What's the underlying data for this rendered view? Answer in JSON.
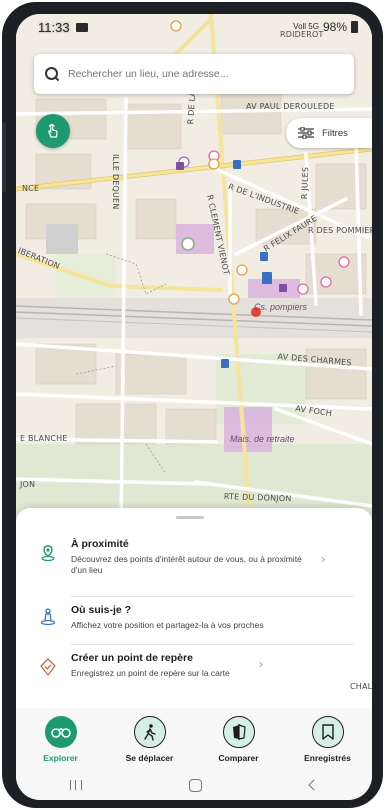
{
  "status_bar": {
    "time": "11:33",
    "network": "Voll 5G",
    "battery": "98%"
  },
  "search": {
    "placeholder": "Rechercher un lieu, une adresse..."
  },
  "map": {
    "filters_label": "Filtres",
    "street_labels": [
      "AV PAUL DEROULEDE",
      "R DE LA BIENFAI",
      "R JULES",
      "R DE L'INDUSTRIE",
      "R CLEMENT VIENOT",
      "R FELIX FAURE",
      "R DES POMMIER",
      "IBERATION",
      "AV DES CHARMES",
      "AV FOCH",
      "RTE DU DONJON",
      "E BLANCHE",
      "ILLE DEQUEN",
      "RDIDEROT",
      "NCE",
      "JON",
      "CHAL"
    ],
    "poi_labels": [
      "Cs. pompiers",
      "Mais. de retraite"
    ]
  },
  "sheet": {
    "items": [
      {
        "title": "À proximité",
        "description": "Découvrez des points d'intérêt autour de vous, ou à proximité d'un lieu"
      },
      {
        "title": "Où suis-je ?",
        "description": "Affichez votre position et partagez-la à vos proches"
      },
      {
        "title": "Créer un point de repère",
        "description": "Enregistrez un point de repère sur la carte"
      }
    ]
  },
  "nav": {
    "items": [
      {
        "label": "Explorer",
        "icon": "binoculars-icon",
        "active": true
      },
      {
        "label": "Se déplacer",
        "icon": "walking-icon",
        "active": false
      },
      {
        "label": "Comparer",
        "icon": "compare-map-icon",
        "active": false
      },
      {
        "label": "Enregistrés",
        "icon": "bookmark-icon",
        "active": false
      }
    ]
  },
  "colors": {
    "accent": "#1e9a73",
    "nav_icon_bg": "#d6efe6",
    "map_background": "#f1ede3",
    "building": "#e5ddd0",
    "poi_purple": "#d9b3de",
    "road_yellow": "#f7e49b"
  }
}
